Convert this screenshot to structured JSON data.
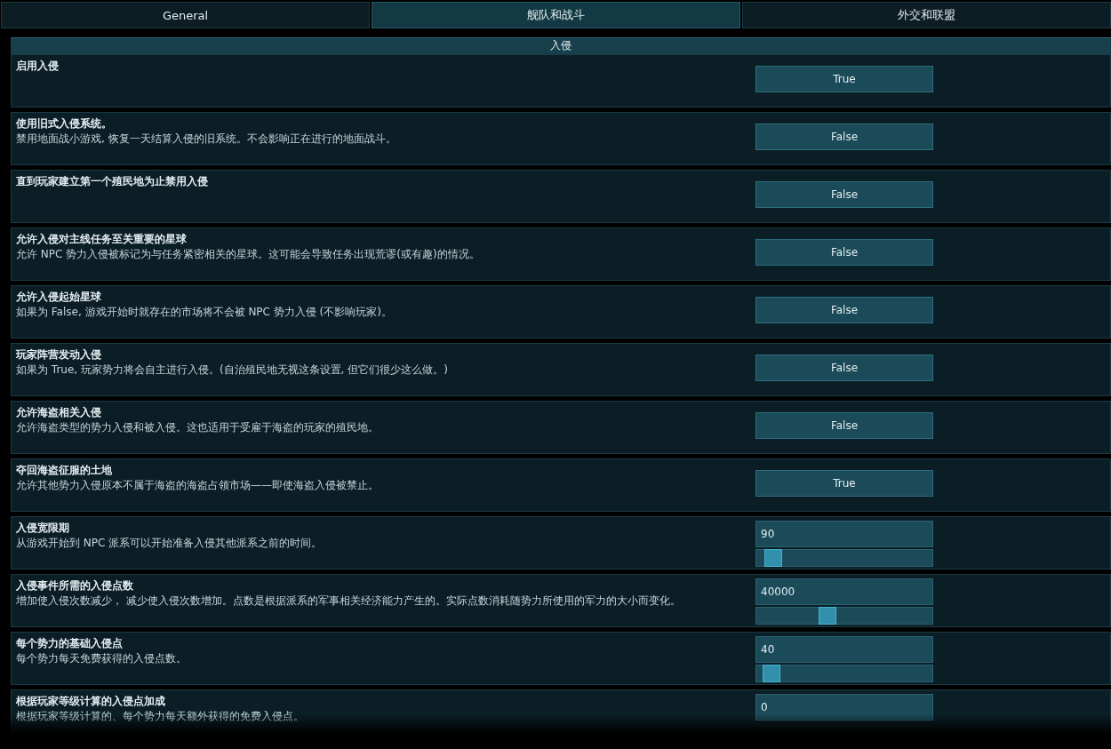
{
  "tabs": [
    {
      "label": "General",
      "selected": false
    },
    {
      "label": "舰队和战斗",
      "selected": true
    },
    {
      "label": "外交和联盟",
      "selected": false
    }
  ],
  "section": {
    "title": "入侵"
  },
  "settings": [
    {
      "kind": "toggle",
      "title": "启用入侵",
      "value": "True"
    },
    {
      "kind": "toggle",
      "title": "使用旧式入侵系统。",
      "description": "禁用地面战小游戏, 恢复一天结算入侵的旧系统。不会影响正在进行的地面战斗。",
      "value": "False"
    },
    {
      "kind": "toggle",
      "title": "直到玩家建立第一个殖民地为止禁用入侵",
      "value": "False"
    },
    {
      "kind": "toggle",
      "title": "允许入侵对主线任务至关重要的星球",
      "description": "允许 NPC 势力入侵被标记为与任务紧密相关的星球。这可能会导致任务出现荒谬(或有趣)的情况。",
      "value": "False"
    },
    {
      "kind": "toggle",
      "title": "允许入侵起始星球",
      "description": "如果为 False, 游戏开始时就存在的市场将不会被 NPC 势力入侵 (不影响玩家)。",
      "value": "False"
    },
    {
      "kind": "toggle",
      "title": "玩家阵营发动入侵",
      "description": "如果为 True, 玩家势力将会自主进行入侵。(自治殖民地无视这条设置, 但它们很少这么做。)",
      "value": "False"
    },
    {
      "kind": "toggle",
      "title": "允许海盗相关入侵",
      "description": "允许海盗类型的势力入侵和被入侵。这也适用于受雇于海盗的玩家的殖民地。",
      "value": "False"
    },
    {
      "kind": "toggle",
      "title": "夺回海盗征服的土地",
      "description": "允许其他势力入侵原本不属于海盗的海盗占领市场——即使海盗入侵被禁止。",
      "value": "True"
    },
    {
      "kind": "slider",
      "title": "入侵宽限期",
      "description": "从游戏开始到 NPC 派系可以开始准备入侵其他派系之前的时间。",
      "value": "90",
      "level": 0.05
    },
    {
      "kind": "slider",
      "title": "入侵事件所需的入侵点数",
      "description": "增加使入侵次数减少， 减少使入侵次数增加。点数是根据派系的军事相关经济能力产生的。实际点数消耗随势力所使用的军力的大小而变化。",
      "value": "40000",
      "level": 0.39
    },
    {
      "kind": "slider",
      "title": "每个势力的基础入侵点",
      "description": "每个势力每天免费获得的入侵点数。",
      "value": "40",
      "level": 0.04
    },
    {
      "kind": "slider",
      "title": "根据玩家等级计算的入侵点加成",
      "description": "根据玩家等级计算的、每个势力每天额外获得的免费入侵点。",
      "value": "0"
    }
  ]
}
